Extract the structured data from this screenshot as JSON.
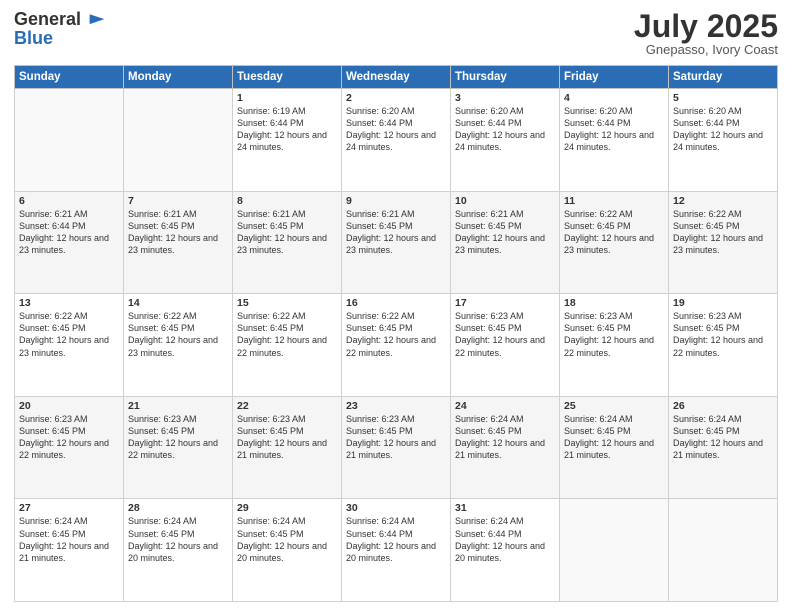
{
  "logo": {
    "general": "General",
    "blue": "Blue"
  },
  "header": {
    "month": "July 2025",
    "location": "Gnepasso, Ivory Coast"
  },
  "days_of_week": [
    "Sunday",
    "Monday",
    "Tuesday",
    "Wednesday",
    "Thursday",
    "Friday",
    "Saturday"
  ],
  "weeks": [
    [
      {
        "day": "",
        "sunrise": "",
        "sunset": "",
        "daylight": ""
      },
      {
        "day": "",
        "sunrise": "",
        "sunset": "",
        "daylight": ""
      },
      {
        "day": "1",
        "sunrise": "Sunrise: 6:19 AM",
        "sunset": "Sunset: 6:44 PM",
        "daylight": "Daylight: 12 hours and 24 minutes."
      },
      {
        "day": "2",
        "sunrise": "Sunrise: 6:20 AM",
        "sunset": "Sunset: 6:44 PM",
        "daylight": "Daylight: 12 hours and 24 minutes."
      },
      {
        "day": "3",
        "sunrise": "Sunrise: 6:20 AM",
        "sunset": "Sunset: 6:44 PM",
        "daylight": "Daylight: 12 hours and 24 minutes."
      },
      {
        "day": "4",
        "sunrise": "Sunrise: 6:20 AM",
        "sunset": "Sunset: 6:44 PM",
        "daylight": "Daylight: 12 hours and 24 minutes."
      },
      {
        "day": "5",
        "sunrise": "Sunrise: 6:20 AM",
        "sunset": "Sunset: 6:44 PM",
        "daylight": "Daylight: 12 hours and 24 minutes."
      }
    ],
    [
      {
        "day": "6",
        "sunrise": "Sunrise: 6:21 AM",
        "sunset": "Sunset: 6:44 PM",
        "daylight": "Daylight: 12 hours and 23 minutes."
      },
      {
        "day": "7",
        "sunrise": "Sunrise: 6:21 AM",
        "sunset": "Sunset: 6:45 PM",
        "daylight": "Daylight: 12 hours and 23 minutes."
      },
      {
        "day": "8",
        "sunrise": "Sunrise: 6:21 AM",
        "sunset": "Sunset: 6:45 PM",
        "daylight": "Daylight: 12 hours and 23 minutes."
      },
      {
        "day": "9",
        "sunrise": "Sunrise: 6:21 AM",
        "sunset": "Sunset: 6:45 PM",
        "daylight": "Daylight: 12 hours and 23 minutes."
      },
      {
        "day": "10",
        "sunrise": "Sunrise: 6:21 AM",
        "sunset": "Sunset: 6:45 PM",
        "daylight": "Daylight: 12 hours and 23 minutes."
      },
      {
        "day": "11",
        "sunrise": "Sunrise: 6:22 AM",
        "sunset": "Sunset: 6:45 PM",
        "daylight": "Daylight: 12 hours and 23 minutes."
      },
      {
        "day": "12",
        "sunrise": "Sunrise: 6:22 AM",
        "sunset": "Sunset: 6:45 PM",
        "daylight": "Daylight: 12 hours and 23 minutes."
      }
    ],
    [
      {
        "day": "13",
        "sunrise": "Sunrise: 6:22 AM",
        "sunset": "Sunset: 6:45 PM",
        "daylight": "Daylight: 12 hours and 23 minutes."
      },
      {
        "day": "14",
        "sunrise": "Sunrise: 6:22 AM",
        "sunset": "Sunset: 6:45 PM",
        "daylight": "Daylight: 12 hours and 23 minutes."
      },
      {
        "day": "15",
        "sunrise": "Sunrise: 6:22 AM",
        "sunset": "Sunset: 6:45 PM",
        "daylight": "Daylight: 12 hours and 22 minutes."
      },
      {
        "day": "16",
        "sunrise": "Sunrise: 6:22 AM",
        "sunset": "Sunset: 6:45 PM",
        "daylight": "Daylight: 12 hours and 22 minutes."
      },
      {
        "day": "17",
        "sunrise": "Sunrise: 6:23 AM",
        "sunset": "Sunset: 6:45 PM",
        "daylight": "Daylight: 12 hours and 22 minutes."
      },
      {
        "day": "18",
        "sunrise": "Sunrise: 6:23 AM",
        "sunset": "Sunset: 6:45 PM",
        "daylight": "Daylight: 12 hours and 22 minutes."
      },
      {
        "day": "19",
        "sunrise": "Sunrise: 6:23 AM",
        "sunset": "Sunset: 6:45 PM",
        "daylight": "Daylight: 12 hours and 22 minutes."
      }
    ],
    [
      {
        "day": "20",
        "sunrise": "Sunrise: 6:23 AM",
        "sunset": "Sunset: 6:45 PM",
        "daylight": "Daylight: 12 hours and 22 minutes."
      },
      {
        "day": "21",
        "sunrise": "Sunrise: 6:23 AM",
        "sunset": "Sunset: 6:45 PM",
        "daylight": "Daylight: 12 hours and 22 minutes."
      },
      {
        "day": "22",
        "sunrise": "Sunrise: 6:23 AM",
        "sunset": "Sunset: 6:45 PM",
        "daylight": "Daylight: 12 hours and 21 minutes."
      },
      {
        "day": "23",
        "sunrise": "Sunrise: 6:23 AM",
        "sunset": "Sunset: 6:45 PM",
        "daylight": "Daylight: 12 hours and 21 minutes."
      },
      {
        "day": "24",
        "sunrise": "Sunrise: 6:24 AM",
        "sunset": "Sunset: 6:45 PM",
        "daylight": "Daylight: 12 hours and 21 minutes."
      },
      {
        "day": "25",
        "sunrise": "Sunrise: 6:24 AM",
        "sunset": "Sunset: 6:45 PM",
        "daylight": "Daylight: 12 hours and 21 minutes."
      },
      {
        "day": "26",
        "sunrise": "Sunrise: 6:24 AM",
        "sunset": "Sunset: 6:45 PM",
        "daylight": "Daylight: 12 hours and 21 minutes."
      }
    ],
    [
      {
        "day": "27",
        "sunrise": "Sunrise: 6:24 AM",
        "sunset": "Sunset: 6:45 PM",
        "daylight": "Daylight: 12 hours and 21 minutes."
      },
      {
        "day": "28",
        "sunrise": "Sunrise: 6:24 AM",
        "sunset": "Sunset: 6:45 PM",
        "daylight": "Daylight: 12 hours and 20 minutes."
      },
      {
        "day": "29",
        "sunrise": "Sunrise: 6:24 AM",
        "sunset": "Sunset: 6:45 PM",
        "daylight": "Daylight: 12 hours and 20 minutes."
      },
      {
        "day": "30",
        "sunrise": "Sunrise: 6:24 AM",
        "sunset": "Sunset: 6:44 PM",
        "daylight": "Daylight: 12 hours and 20 minutes."
      },
      {
        "day": "31",
        "sunrise": "Sunrise: 6:24 AM",
        "sunset": "Sunset: 6:44 PM",
        "daylight": "Daylight: 12 hours and 20 minutes."
      },
      {
        "day": "",
        "sunrise": "",
        "sunset": "",
        "daylight": ""
      },
      {
        "day": "",
        "sunrise": "",
        "sunset": "",
        "daylight": ""
      }
    ]
  ]
}
